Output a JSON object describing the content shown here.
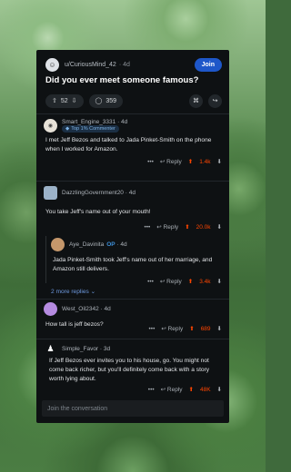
{
  "post": {
    "author": "u/CuriousMind_42",
    "time": "· 4d",
    "join_label": "Join",
    "title": "Did you ever meet someone famous?",
    "votes": "52",
    "comments": "359"
  },
  "comments": [
    {
      "author": "Smart_Engine_3331",
      "time": "· 4d",
      "badge": "Top 1% Commenter",
      "body": "I met Jeff Bezos and talked to Jada Pinket-Smith on the phone when I worked for Amazon.",
      "reply_label": "Reply",
      "votes": "1.4k"
    },
    {
      "author": "DazzlingGovernment20",
      "time": "· 4d",
      "body": "You take Jeff's name out of your mouth!",
      "reply_label": "Reply",
      "votes": "20.0k"
    },
    {
      "author": "Aye_Davinita",
      "op_label": "OP",
      "time": "· 4d",
      "body": "Jada Pinket-Smith took Jeff's name out of her marriage, and Amazon still delivers.",
      "reply_label": "Reply",
      "votes": "3.4k"
    },
    {
      "author": "West_Oil2342",
      "time": "· 4d",
      "body": "How tall is jeff bezos?",
      "reply_label": "Reply",
      "votes": "689"
    },
    {
      "author": "Simple_Favor",
      "time": "· 3d",
      "body": "If Jeff Bezos ever invites you to his house, go. You might not come back richer, but you'll definitely come back with a story worth lying about.",
      "reply_label": "Reply",
      "votes": "48K"
    }
  ],
  "more_replies": "2 more replies",
  "input_placeholder": "Join the conversation",
  "colors": {
    "upvote": "#ff4500",
    "join": "#1e57c9",
    "card": "#0e1113"
  }
}
